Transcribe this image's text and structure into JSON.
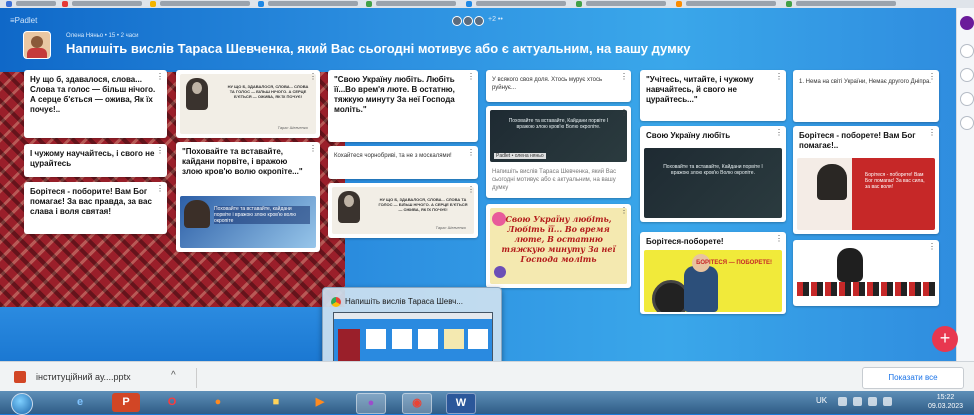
{
  "padlet": {
    "brand": "≡Padlet",
    "author_line": "Олена Няньо • 15 • 2 часи",
    "title": "Напишіть вислів Тараса Шевченка, який Вас сьогодні мотивує або є актуальним, на вашу думку",
    "presence_count": "+2 ••",
    "add_button": "+"
  },
  "cards": {
    "c1": "Ну що б, здавалося, слова... Слова та голос — більш нічого. А серце б'ється — ожива, Як їх почує!..",
    "c2": "І чужому научайтесь, і свого не цурайтесь",
    "c3": "Борітеся - поборите! Вам Бог помагає! За вас правда, за вас слава і воля святая!",
    "c4_img_caption": "НУ ЩО Б, ЗДАВАЛОСЯ, СЛОВА... СЛОВА ТА ГОЛОС — БІЛЬШ НІЧОГО. А СЕРЦЕ Б'ЄТЬСЯ — ОЖИВА, ЯК ЇХ ПОЧУЄ!",
    "c4_img_signature": "Тарас Шевченко",
    "c5": "\"Поховайте та вставайте, кайдани порвіте, і вражою злою кров'ю волю окропіте...\"",
    "c5_img_caption": "Поховайте та вставайте, кайдани порвіте і вражою злою кров'ю волю окропіте",
    "c6": "\"Свою Україну любіть. Любіть її...Во врем'я люте. В остатню, тяжкую минуту За неї Господа моліть.\"",
    "c7": "Кохайтеся чорнобриві, та не з москалями!",
    "c8_img_caption": "НУ ЩО Б, ЗДАВАЛОСЯ, СЛОВА... СЛОВА ТА ГОЛОС — БІЛЬШ НІЧОГО. А СЕРЦЕ Б'ЄТЬСЯ — ОЖИВА, ЯК ЇХ ПОЧУЄ!",
    "c8_img_signature": "Тарас Шевченко",
    "c9": "У всякого своя доля. Хтось мурує хтось руйнує...",
    "c10_img_caption": "Поховайте та вставайте, Кайдани порвіте І вражою злою кров'ю Волю окропіте.",
    "c10_label": "Padlet • олена няньо",
    "c10_desc": "Напишіть вислів Тараса Шевченка, який Вас сьогодні мотивує або є актуальним, на вашу думку",
    "c11_img_caption": "Свою Україну любіть, Любіть її... Во время люте, В остатню тяжкую минуту За неї Господа моліть",
    "c12": "\"Учітесь, читайте, і чужому навчайтесь, й свого не цурайтесь...\"",
    "c13": "Свою Україну любіть",
    "c13_img_caption": "Поховайте та вставайте, Кайдани порвіте І вражою злою кров'ю Волю окропіте.",
    "c14": "Борітеся-поборете!",
    "c14_img_text": "БОРІТЕСЯ — ПОБОРЕТЕ!",
    "c15": "1. Нема на світі України, Немає другого Дніпра.",
    "c16": "Борітеся - поборете! Вам Бог помагає!..",
    "c16_img_caption": "Борітеся - поборете! Вам Бог помагає! За вас сила, за вас воля!"
  },
  "thumbnail": {
    "title": "Напишіть вислів Тараса Шевч..."
  },
  "downloads": {
    "file_name": "інституційний ау....pptx",
    "caret": "^",
    "show_all": "Показати все"
  },
  "taskbar": {
    "ppt_label": "P",
    "word_label": "W",
    "lang": "UK",
    "time": "15:22",
    "date": "09.03.2023"
  },
  "colors": {
    "padlet_background": "#2c8fe0",
    "ornament_red": "#9a1f2a",
    "add_button": "#e8374f",
    "taskbar": "#2f5c86"
  },
  "icons": [
    "padlet-logo-icon",
    "avatar",
    "more-dots-icon",
    "plus-icon",
    "chrome-icon",
    "powerpoint-icon",
    "opera-icon",
    "firefox-icon",
    "folder-icon",
    "word-icon",
    "windows-start-icon"
  ]
}
